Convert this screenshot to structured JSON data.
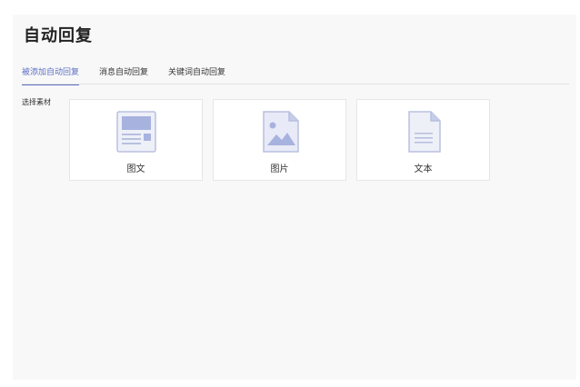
{
  "page": {
    "title": "自动回复"
  },
  "tabs": [
    {
      "label": "被添加自动回复",
      "active": true
    },
    {
      "label": "消息自动回复",
      "active": false
    },
    {
      "label": "关键词自动回复",
      "active": false
    }
  ],
  "material": {
    "label": "选择素材",
    "cards": [
      {
        "label": "图文",
        "icon": "article-icon"
      },
      {
        "label": "图片",
        "icon": "image-icon"
      },
      {
        "label": "文本",
        "icon": "text-file-icon"
      }
    ]
  },
  "colors": {
    "accent": "#5b6fc2",
    "icon": "#c6cde8",
    "icon_dark": "#9aa5d4"
  }
}
